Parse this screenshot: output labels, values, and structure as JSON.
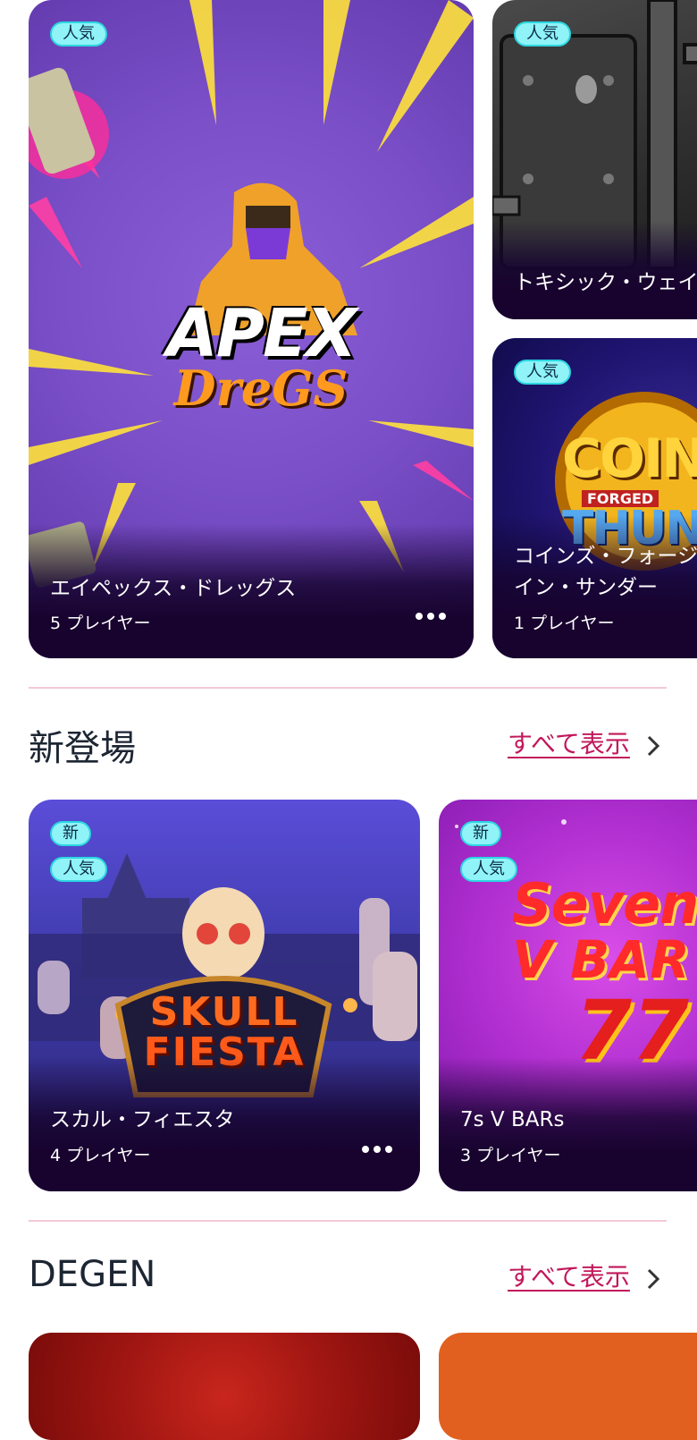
{
  "top_row": {
    "main_card": {
      "badge": "人気",
      "title": "エイペックス・ドレッグス",
      "players": "5 プレイヤー",
      "logo_top": "APEX",
      "logo_bottom": "DreGS"
    },
    "side_card_1": {
      "badge": "人気",
      "title": "トキシック・ウェイ"
    },
    "side_card_2": {
      "badge": "人気",
      "title_line1": "コインズ・フォージ",
      "title_line2": "イン・サンダー",
      "players": "1 プレイヤー",
      "logo_top": "COIN",
      "logo_mid": "FORGED",
      "logo_bottom": "THUNI"
    }
  },
  "new_section": {
    "title": "新登場",
    "see_all": "すべて表示",
    "cards": [
      {
        "badge_new": "新",
        "badge_popular": "人気",
        "title": "スカル・フィエスタ",
        "players": "4 プレイヤー",
        "logo_top": "SKULL",
        "logo_bottom": "FIESTA"
      },
      {
        "badge_new": "新",
        "badge_popular": "人気",
        "title": "7s V BARs",
        "players": "3 プレイヤー",
        "logo_top": "Seven",
        "logo_mid": "V BAR",
        "logo_bottom": "77"
      }
    ]
  },
  "degen_section": {
    "title": "DEGEN",
    "see_all": "すべて表示"
  },
  "colors": {
    "accent": "#c2185b",
    "badge_bg": "#8ff3f7",
    "card_shade": "#18032f",
    "divider": "#f3c9d6"
  }
}
